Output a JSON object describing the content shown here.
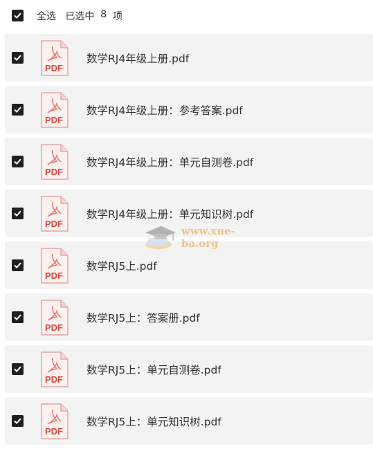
{
  "header": {
    "select_all": "全选",
    "selected_prefix": "已选中",
    "selected_count": "8",
    "selected_suffix": "项"
  },
  "files": [
    {
      "name": "数学RJ4年级上册.pdf",
      "icon": "pdf-icon"
    },
    {
      "name": "数学RJ4年级上册：参考答案.pdf",
      "icon": "pdf-icon"
    },
    {
      "name": "数学RJ4年级上册：单元自测卷.pdf",
      "icon": "pdf-icon"
    },
    {
      "name": "数学RJ4年级上册：单元知识树.pdf",
      "icon": "pdf-icon"
    },
    {
      "name": "数学RJ5上.pdf",
      "icon": "pdf-icon"
    },
    {
      "name": "数学RJ5上：答案册.pdf",
      "icon": "pdf-icon"
    },
    {
      "name": "数学RJ5上：单元自测卷.pdf",
      "icon": "pdf-icon"
    },
    {
      "name": "数学RJ5上：单元知识树.pdf",
      "icon": "pdf-icon"
    }
  ],
  "pdf_label": "PDF",
  "watermark": "www.xue-ba.org",
  "colors": {
    "checkbox": "#1f1f1f",
    "pdf_red": "#e0483d",
    "row_bg": "#f3f3f3"
  }
}
